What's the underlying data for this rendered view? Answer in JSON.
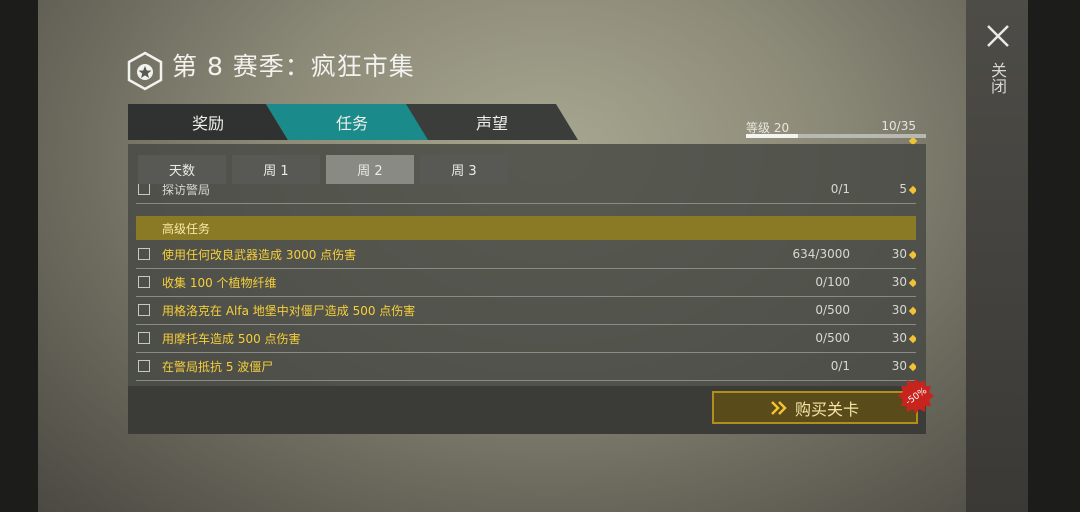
{
  "header": {
    "title": "第 8 赛季：疯狂市集"
  },
  "close": {
    "label": "关闭"
  },
  "tabs": [
    {
      "label": "奖励"
    },
    {
      "label": "任务"
    },
    {
      "label": "声望"
    }
  ],
  "level": {
    "label": "等级 20",
    "count": "10/35",
    "progress": 0.29
  },
  "subtabs": [
    {
      "label": "天数"
    },
    {
      "label": "周 1"
    },
    {
      "label": "周 2"
    },
    {
      "label": "周 3"
    }
  ],
  "partial_row": {
    "title": "探访警局",
    "progress": "0/1",
    "reward": "5"
  },
  "section": {
    "title": "高级任务"
  },
  "missions": [
    {
      "title": "使用任何改良武器造成 3000 点伤害",
      "progress": "634/3000",
      "reward": "30"
    },
    {
      "title": "收集 100 个植物纤维",
      "progress": "0/100",
      "reward": "30"
    },
    {
      "title": "用格洛克在 Alfa 地堡中对僵尸造成 500 点伤害",
      "progress": "0/500",
      "reward": "30"
    },
    {
      "title": "用摩托车造成 500 点伤害",
      "progress": "0/500",
      "reward": "30"
    },
    {
      "title": "在警局抵抗 5 波僵尸",
      "progress": "0/1",
      "reward": "30"
    }
  ],
  "buy": {
    "label": "购买关卡",
    "discount": "-50%"
  },
  "colors": {
    "accent": "#1b8a8b",
    "gold": "#f6cf3a",
    "badge": "#c8231c"
  }
}
